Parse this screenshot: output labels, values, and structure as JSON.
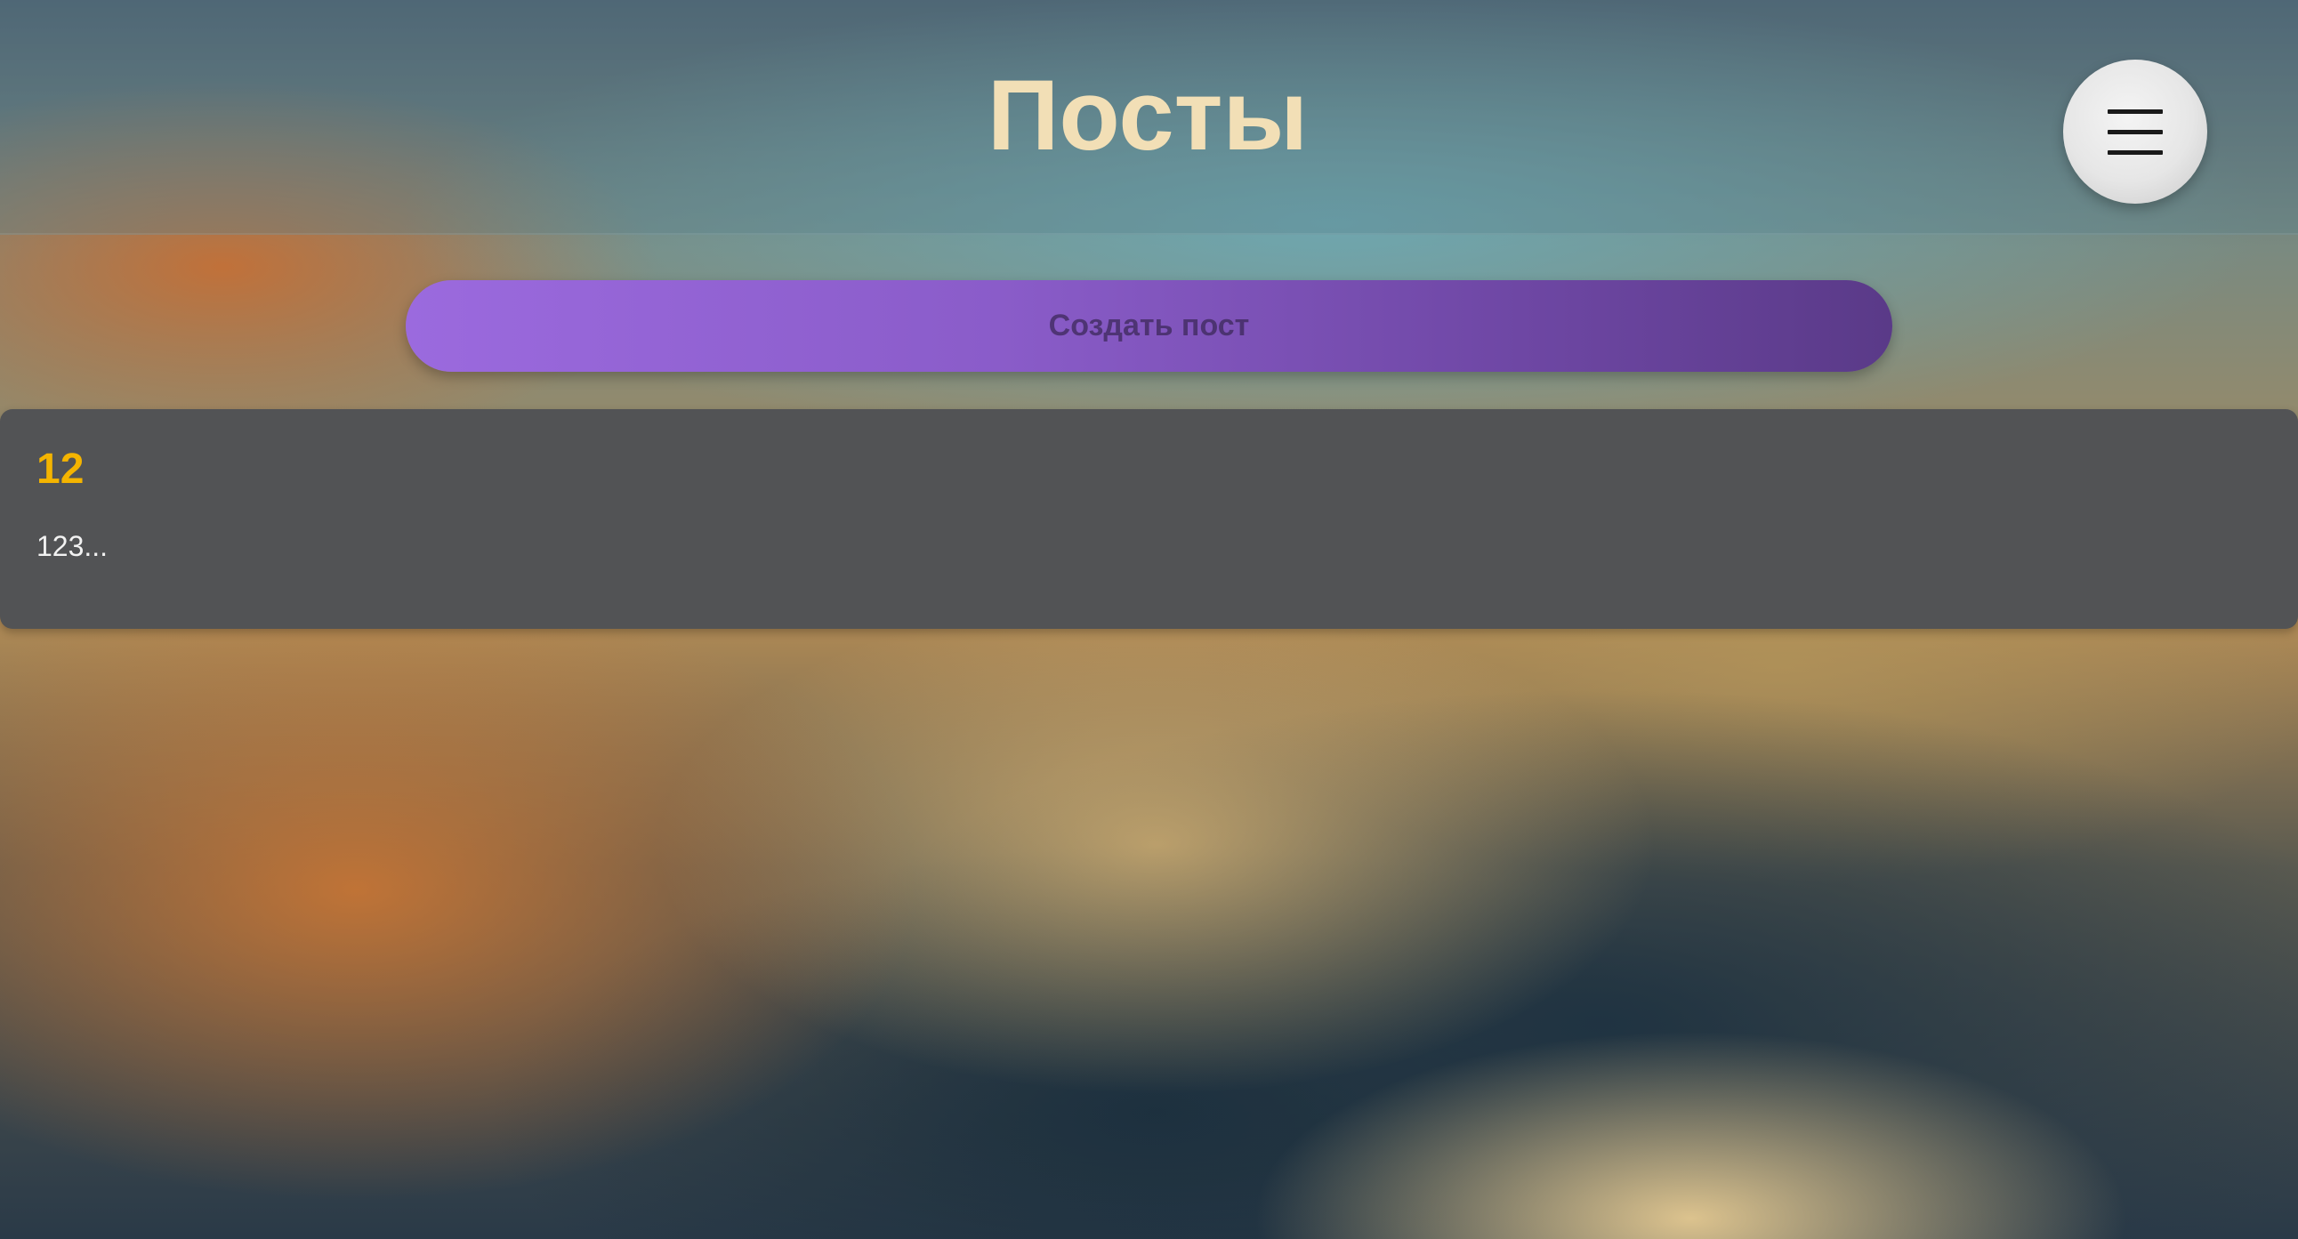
{
  "header": {
    "title": "Посты",
    "menu_icon": "hamburger-menu-icon"
  },
  "actions": {
    "create_post_label": "Создать пост"
  },
  "posts": [
    {
      "title": "12",
      "excerpt": "123..."
    }
  ],
  "colors": {
    "title": "#f2dfb6",
    "post_title": "#f4b400",
    "card_background": "#525355",
    "button_gradient_start": "#9b6ade",
    "button_gradient_end": "#5a3a88"
  }
}
